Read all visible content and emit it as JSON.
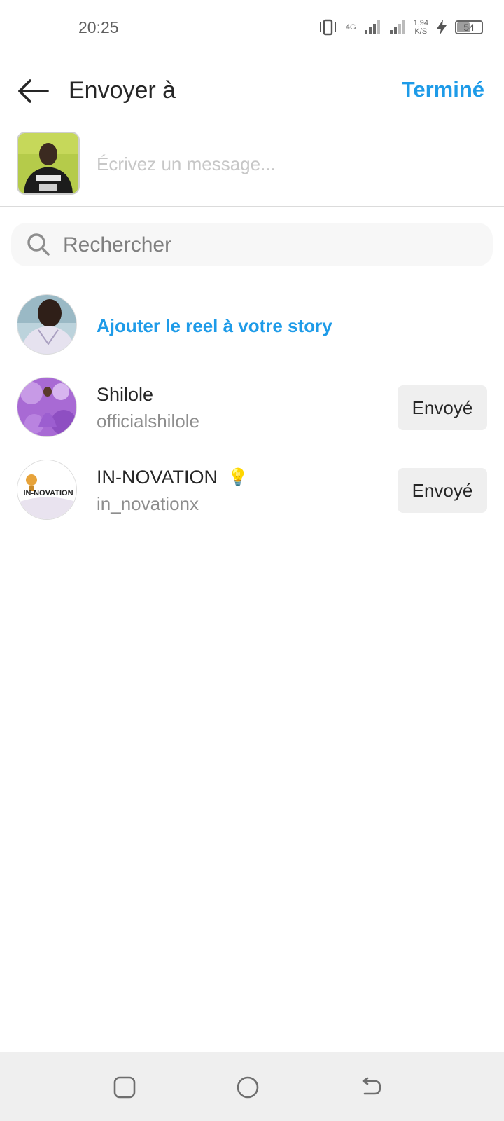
{
  "status_bar": {
    "time": "20:25",
    "network": "4G",
    "speed_value": "1,94",
    "speed_unit": "K/S",
    "battery": "54",
    "battery_level": 0.54
  },
  "header": {
    "title": "Envoyer à",
    "done_label": "Terminé"
  },
  "composer": {
    "placeholder": "Écrivez un message..."
  },
  "search": {
    "placeholder": "Rechercher"
  },
  "story": {
    "label": "Ajouter le reel à votre story"
  },
  "contacts": [
    {
      "name": "Shilole",
      "username": "officialshilole",
      "button": "Envoyé"
    },
    {
      "name": "IN-NOVATION",
      "emoji": "💡",
      "username": "in_novationx",
      "button": "Envoyé",
      "avatar_text": "IN-NOVATION"
    }
  ],
  "nav": {
    "icons": [
      "recent-apps-icon",
      "home-icon",
      "back-icon"
    ]
  },
  "colors": {
    "accent": "#1e9be8",
    "button_bg": "#efefef",
    "secondary_text": "#8e8e8e"
  }
}
